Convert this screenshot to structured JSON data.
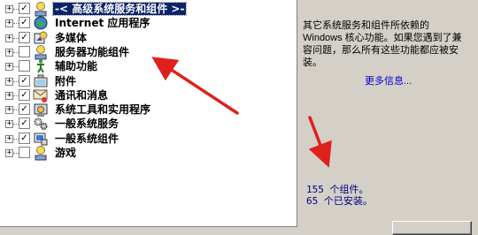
{
  "tree": {
    "items": [
      {
        "label": "-< 高级系统服务和组件 >-",
        "checked": true,
        "icon": "info-bulb-icon",
        "selected": true
      },
      {
        "label": "Internet 应用程序",
        "checked": true,
        "icon": "globe-icon"
      },
      {
        "label": "多媒体",
        "checked": true,
        "icon": "multimedia-icon"
      },
      {
        "label": "服务器功能组件",
        "checked": false,
        "icon": "info-bulb-icon"
      },
      {
        "label": "辅助功能",
        "checked": false,
        "icon": "accessibility-icon"
      },
      {
        "label": "附件",
        "checked": true,
        "icon": "accessories-icon"
      },
      {
        "label": "通讯和消息",
        "checked": true,
        "icon": "communication-icon"
      },
      {
        "label": "系统工具和实用程序",
        "checked": true,
        "icon": "system-tools-icon"
      },
      {
        "label": "一般系统服务",
        "checked": true,
        "icon": "gears-icon"
      },
      {
        "label": "一般系统组件",
        "checked": true,
        "icon": "components-icon"
      },
      {
        "label": "游戏",
        "checked": false,
        "icon": "info-bulb-icon"
      }
    ]
  },
  "info": {
    "description": "其它系统服务和组件所依赖的 Windows 核心功能。如果您遇到了兼容问题，那么所有这些功能都应被安装。",
    "more_link": "更多信息...",
    "total_components": "155 个组件。",
    "installed_components": "65 个已安装。"
  },
  "colors": {
    "selection": "#0a246a",
    "annotation_arrow": "#e0201c",
    "link": "#0000cc"
  }
}
